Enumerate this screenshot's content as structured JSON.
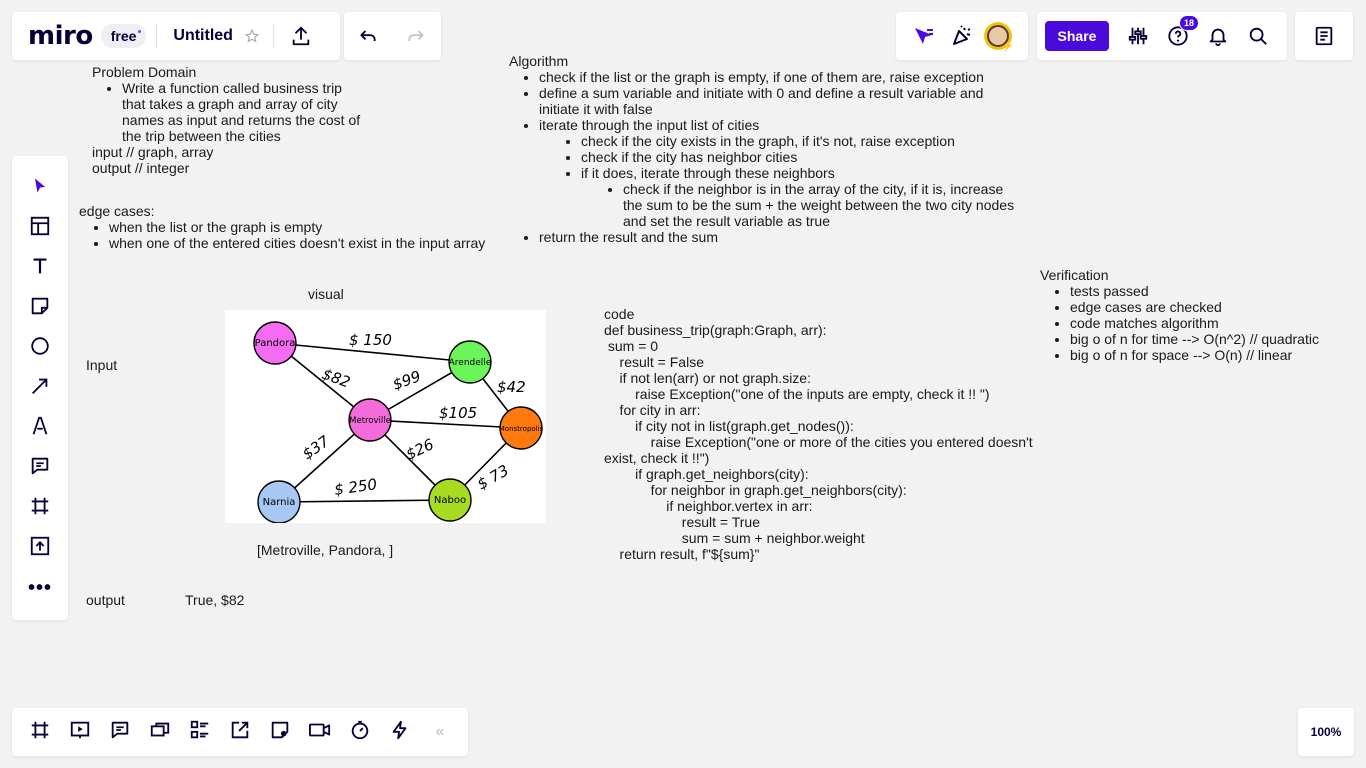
{
  "topbar": {
    "logo": "miro",
    "plan_badge": "free",
    "board_title": "Untitled",
    "share_label": "Share",
    "notifications_count": "18"
  },
  "zoom": "100%",
  "canvas": {
    "problem_domain": {
      "heading": "Problem Domain",
      "bullet": "Write a function called business trip that takes a graph and array of city names as input and returns the cost of the trip between the cities",
      "input_line": "input // graph, array",
      "output_line": "output // integer"
    },
    "edge_cases": {
      "heading": "edge cases:",
      "items": [
        "when the list or the graph is empty",
        "when one of the entered cities doesn't exist in the input array"
      ]
    },
    "algorithm": {
      "heading": "Algorithm",
      "b1": "check if the list or the graph is empty, if one of them are, raise exception",
      "b2": "define a sum variable and initiate with 0 and define a result variable and initiate it with false",
      "b3": "iterate through the input list of cities",
      "b3a": "check if the city exists in the graph, if it's not, raise exception",
      "b3b": "check if the city has neighbor cities",
      "b3c": "if it does, iterate through these neighbors",
      "b3c1": "check if the neighbor is in the array of the city, if it is, increase the sum to be the sum + the weight between the two city nodes and set the result variable as true",
      "b4": "return the result and the sum"
    },
    "verification": {
      "heading": "Verification",
      "items": [
        "tests passed",
        "edge cases are checked",
        "code matches algorithm",
        "big o of n for time --> O(n^2) // quadratic",
        "big o of n for space --> O(n) // linear"
      ]
    },
    "visual_label": "visual",
    "input_label": "Input",
    "input_value": "[Metroville, Pandora, ]",
    "output_label": "output",
    "output_value": "True, $82",
    "graph": {
      "nodes": [
        "Pandora",
        "Arendelle",
        "Metroville",
        "Monstropolis",
        "Narnia",
        "Naboo"
      ],
      "edge_labels": [
        "$ 150",
        "$82",
        "$99",
        "$42",
        "$105",
        "$37",
        "$26",
        "$ 250",
        "$ 73"
      ]
    },
    "code": {
      "heading": "code",
      "lines": [
        "def business_trip(graph:Graph, arr):",
        " sum = 0",
        "    result = False",
        "    if not len(arr) or not graph.size:",
        "        raise Exception(\"one of the inputs are empty, check it !! \")",
        "    for city in arr:",
        "        if city not in list(graph.get_nodes()):",
        "            raise Exception(\"one or more of the cities you entered doesn't",
        "exist, check it !!\")",
        "        if graph.get_neighbors(city):",
        "            for neighbor in graph.get_neighbors(city):",
        "                if neighbor.vertex in arr:",
        "                    result = True",
        "                    sum = sum + neighbor.weight",
        "    return result, f\"${sum}\""
      ]
    }
  },
  "colors": {
    "accent": "#4262ff",
    "share_bg": "#4a0adb",
    "pandora": "#f46cf2",
    "arendelle": "#6cf55a",
    "metroville": "#f46cdc",
    "monstropolis": "#ff7a0e",
    "narnia": "#a6c8f2",
    "naboo": "#a8dc22"
  }
}
